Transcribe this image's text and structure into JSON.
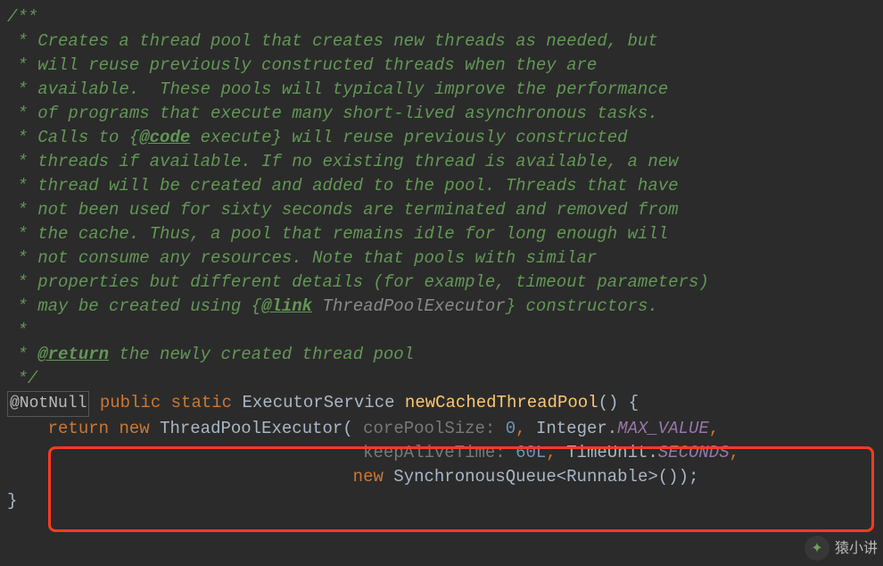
{
  "javadoc": {
    "open": "/**",
    "lines": [
      "Creates a thread pool that creates new threads as needed, but",
      "will reuse previously constructed threads when they are",
      "available.  These pools will typically improve the performance",
      "of programs that execute many short-lived asynchronous tasks.",
      "threads if available. If no existing thread is available, a new",
      "thread will be created and added to the pool. Threads that have",
      "not been used for sixty seconds are terminated and removed from",
      "the cache. Thus, a pool that remains idle for long enough will",
      "not consume any resources. Note that pools with similar",
      "properties but different details (for example, timeout parameters)"
    ],
    "calls_line_prefix": "Calls to {",
    "code_tag": "@code",
    "calls_line_suffix": " execute} will reuse previously constructed",
    "maybe_prefix": "may be created using {",
    "link_tag": "@link",
    "maybe_mid": " ",
    "link_target": "ThreadPoolExecutor",
    "maybe_suffix": "} constructors.",
    "empty_star": "",
    "return_tag": "@return",
    "return_text": " the newly created thread pool",
    "close": "*/"
  },
  "annotation": "@NotNull",
  "signature": {
    "kw_public": "public",
    "kw_static": "static",
    "ret_type": "ExecutorService",
    "method_name": "newCachedThreadPool",
    "parens_open": "() {"
  },
  "body": {
    "kw_return": "return",
    "kw_new": "new",
    "ctor": "ThreadPoolExecutor",
    "hint_core": "corePoolSize:",
    "val_core": "0",
    "integer_cls": "Integer",
    "max_value": "MAX_VALUE",
    "hint_keep": "keepAliveTime:",
    "val_keep": "60L",
    "timeunit_cls": "TimeUnit",
    "seconds": "SECONDS",
    "kw_new2": "new",
    "queue_type": "SynchronousQueue",
    "generic": "Runnable",
    "tail": "());"
  },
  "close_brace": "}",
  "watermark": "猿小讲"
}
